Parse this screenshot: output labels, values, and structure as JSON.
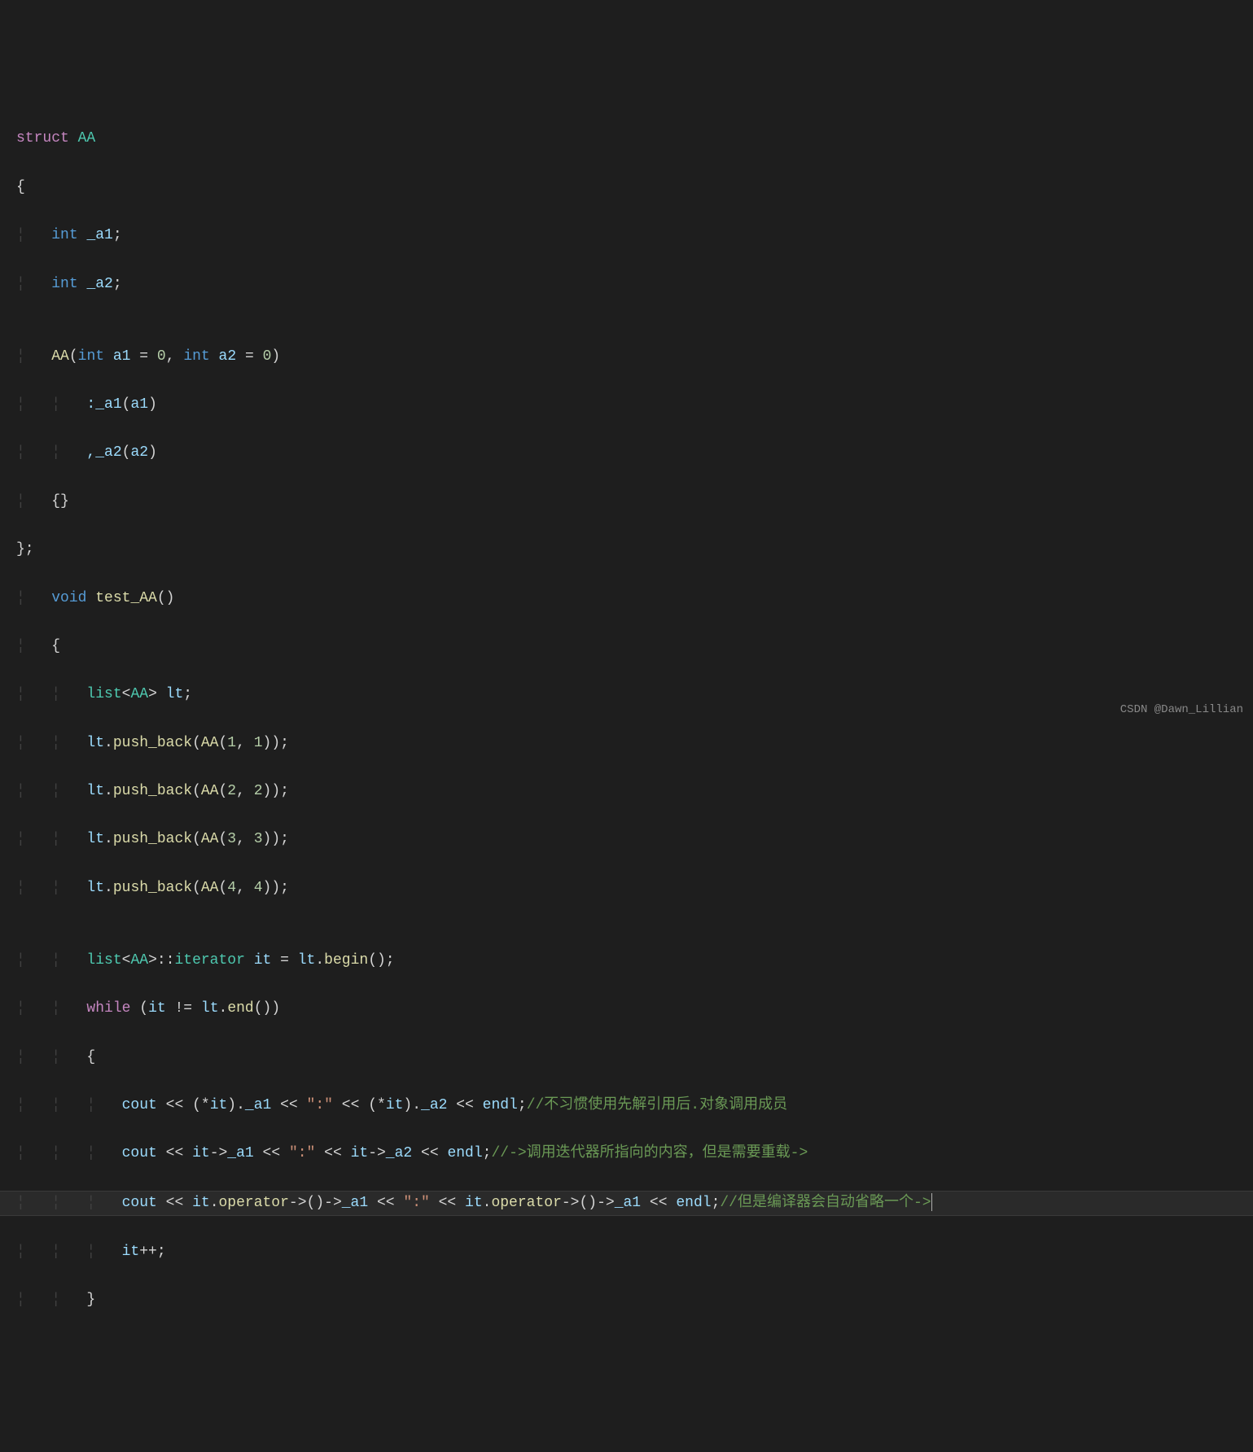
{
  "code": {
    "l1_struct": "struct",
    "l1_name": "AA",
    "l2_brace": "{",
    "l3_type": "int",
    "l3_var": "_a1",
    "l4_type": "int",
    "l4_var": "_a2",
    "l6_name": "AA",
    "l6_type1": "int",
    "l6_p1": "a1",
    "l6_eq": "=",
    "l6_n1": "0",
    "l6_type2": "int",
    "l6_p2": "a2",
    "l6_n2": "0",
    "l7_init1": ":_a1",
    "l7_arg1": "a1",
    "l8_init2": ",_a2",
    "l8_arg2": "a2",
    "l9_braces": "{}",
    "l10_end": "};",
    "l11_void": "void",
    "l11_func": "test_AA",
    "l12_brace": "{",
    "l13_list": "list",
    "l13_aa": "AA",
    "l13_var": "lt",
    "l14_var": "lt",
    "l14_func": "push_back",
    "l14_aa": "AA",
    "l14_n1": "1",
    "l14_n2": "1",
    "l15_n1": "2",
    "l15_n2": "2",
    "l16_n1": "3",
    "l16_n2": "3",
    "l17_n1": "4",
    "l17_n2": "4",
    "l19_list": "list",
    "l19_aa": "AA",
    "l19_iter": "iterator",
    "l19_it": "it",
    "l19_lt": "lt",
    "l19_begin": "begin",
    "l20_while": "while",
    "l20_it": "it",
    "l20_lt": "lt",
    "l20_end": "end",
    "l21_brace": "{",
    "l22_cout": "cout",
    "l22_it": "it",
    "l22_a1": "_a1",
    "l22_str": "\":\"",
    "l22_a2": "_a2",
    "l22_endl": "endl",
    "l22_comment": "//不习惯使用先解引用后.对象调用成员",
    "l23_cout": "cout",
    "l23_it": "it",
    "l23_a1": "_a1",
    "l23_str": "\":\"",
    "l23_a2": "_a2",
    "l23_endl": "endl",
    "l23_comment": "//->调用迭代器所指向的内容，但是需要重载->",
    "l24_cout": "cout",
    "l24_it": "it",
    "l24_op": "operator",
    "l24_a1": "_a1",
    "l24_str": "\":\"",
    "l24_endl": "endl",
    "l24_comment": "//但是编译器会自动省略一个->",
    "l25_it": "it",
    "l25_op": "++",
    "l26_brace": "}"
  },
  "watermark": "CSDN @Dawn_Lillian"
}
